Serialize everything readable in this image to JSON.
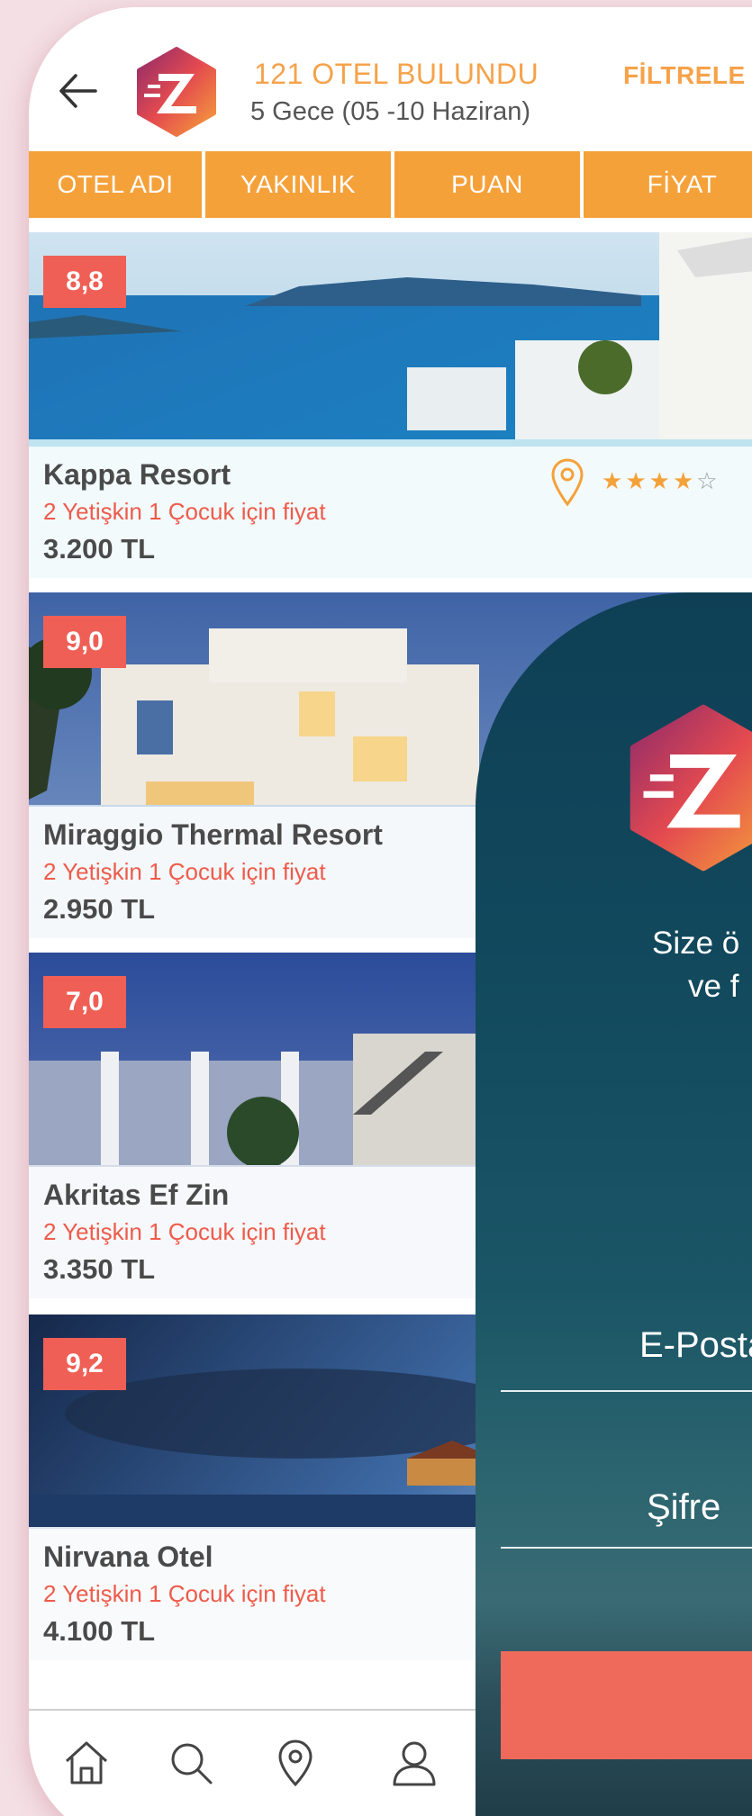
{
  "header": {
    "title": "121 OTEL BULUNDU",
    "subtitle": "5 Gece (05 -10 Haziran)",
    "filter_label": "FİLTRELE"
  },
  "sort_tabs": [
    "OTEL ADI",
    "YAKINLIK",
    "PUAN",
    "FİYAT"
  ],
  "hotels": [
    {
      "score": "8,8",
      "name": "Kappa Resort",
      "guests": "2 Yetişkin 1 Çocuk için fiyat",
      "price": "3.200 TL",
      "stars": 4,
      "max_stars": 5
    },
    {
      "score": "9,0",
      "name": "Miraggio Thermal Resort",
      "guests": "2 Yetişkin 1 Çocuk için fiyat",
      "price": "2.950 TL"
    },
    {
      "score": "7,0",
      "name": "Akritas Ef Zin",
      "guests": "2 Yetişkin 1 Çocuk için fiyat",
      "price": "3.350 TL"
    },
    {
      "score": "9,2",
      "name": "Nirvana Otel",
      "guests": "2 Yetişkin 1 Çocuk için fiyat",
      "price": "4.100 TL"
    }
  ],
  "login": {
    "tagline_line1": "Size ö",
    "tagline_line2": "ve f",
    "email_label": "E-Posta",
    "password_label": "Şifre"
  },
  "nav": [
    "home-icon",
    "search-icon",
    "location-pin-icon",
    "user-icon"
  ],
  "colors": {
    "accent_orange": "#f5a13a",
    "score_red": "#ef5f55",
    "overlay_teal": "#12495d"
  }
}
